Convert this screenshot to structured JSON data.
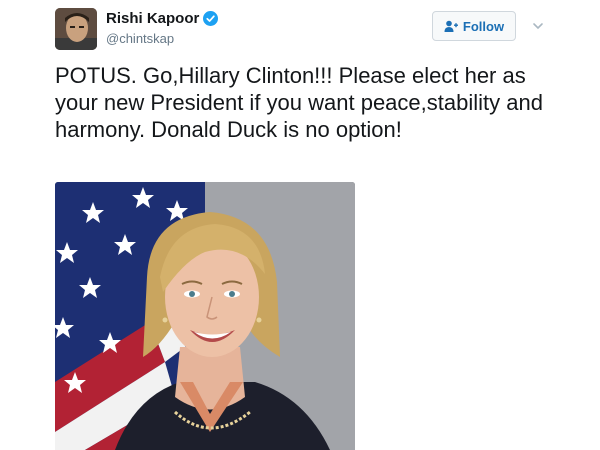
{
  "tweet": {
    "author": {
      "display_name": "Rishi Kapoor",
      "handle": "@chintskap",
      "verified": true
    },
    "follow_button": {
      "label": "Follow",
      "icon": "add-person-icon"
    },
    "menu_icon": "chevron-down-icon",
    "text": "POTUS. Go,Hillary Clinton!!! Please elect her as your new President if you want peace,stability and harmony. Donald Duck is no option!",
    "media": {
      "kind": "portrait-photo"
    }
  },
  "colors": {
    "name": "#14171a",
    "handle": "#657786",
    "verified_badge": "#1da1f2",
    "follow_text": "#1b6fb5",
    "follow_border": "#d0d7dd",
    "photo_background": "#8e9097",
    "flag_blue": "#1d2f73",
    "flag_red": "#b22234"
  }
}
